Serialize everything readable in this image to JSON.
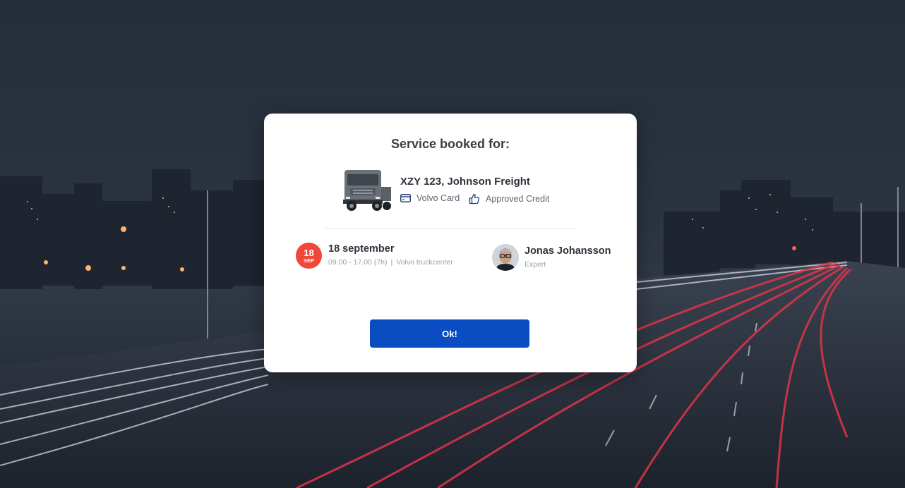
{
  "dialog": {
    "title": "Service booked for:",
    "vehicle": {
      "name": "XZY 123, Johnson Freight",
      "tags": [
        {
          "icon": "credit-card-icon",
          "label": "Volvo Card"
        },
        {
          "icon": "thumbs-up-icon",
          "label": "Approved Credit"
        }
      ]
    },
    "appointment": {
      "day": "18",
      "month": "SEP",
      "date_label": "18 september",
      "time": "09.00 - 17.00 (7h)",
      "separator": "|",
      "location": "Volvo truckcenter"
    },
    "expert": {
      "name": "Jonas Johansson",
      "role": "Expert"
    },
    "ok_label": "Ok!"
  },
  "colors": {
    "accent": "#0a4cc2",
    "date_badge": "#f0473a",
    "background": "#1f2733"
  }
}
